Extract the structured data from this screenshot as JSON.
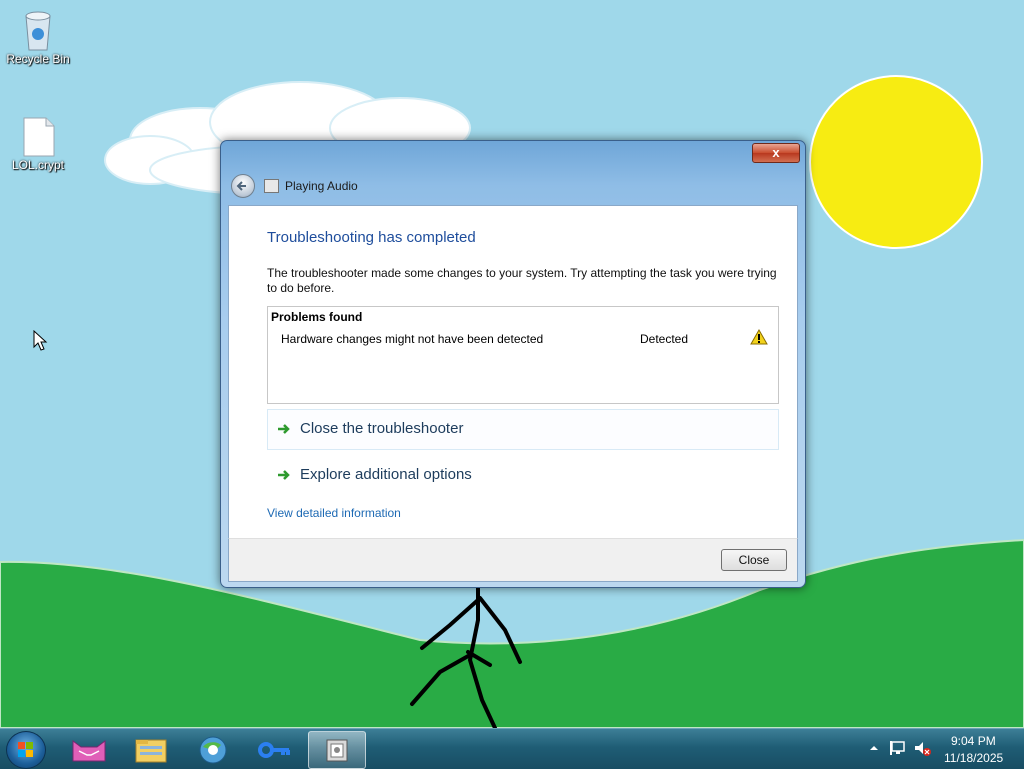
{
  "desktop": {
    "icons": [
      {
        "label": "Recycle Bin"
      },
      {
        "label": "LOL.crypt"
      }
    ]
  },
  "dialog": {
    "title": "Playing Audio",
    "close_glyph": "x",
    "heading": "Troubleshooting has completed",
    "description": "The troubleshooter made some changes to your system. Try attempting the task you were trying to do before.",
    "problems": {
      "header": "Problems found",
      "rows": [
        {
          "name": "Hardware changes might not have been detected",
          "status": "Detected",
          "icon": "warning-icon"
        }
      ]
    },
    "options": [
      {
        "label": "Close the troubleshooter"
      },
      {
        "label": "Explore additional options"
      }
    ],
    "details_link": "View detailed information",
    "close_button": "Close"
  },
  "taskbar": {
    "pinned": [
      "cat-app-icon",
      "file-explorer-icon",
      "browser-icon",
      "key-icon",
      "troubleshooter-icon"
    ],
    "clock": {
      "time": "9:04 PM",
      "date": "11/18/2025"
    }
  },
  "colors": {
    "sky": "#9fd8ea",
    "grass": "#29ab45",
    "sun": "#f7ec12",
    "heading": "#1e4d9c",
    "link": "#1e6ab4"
  }
}
